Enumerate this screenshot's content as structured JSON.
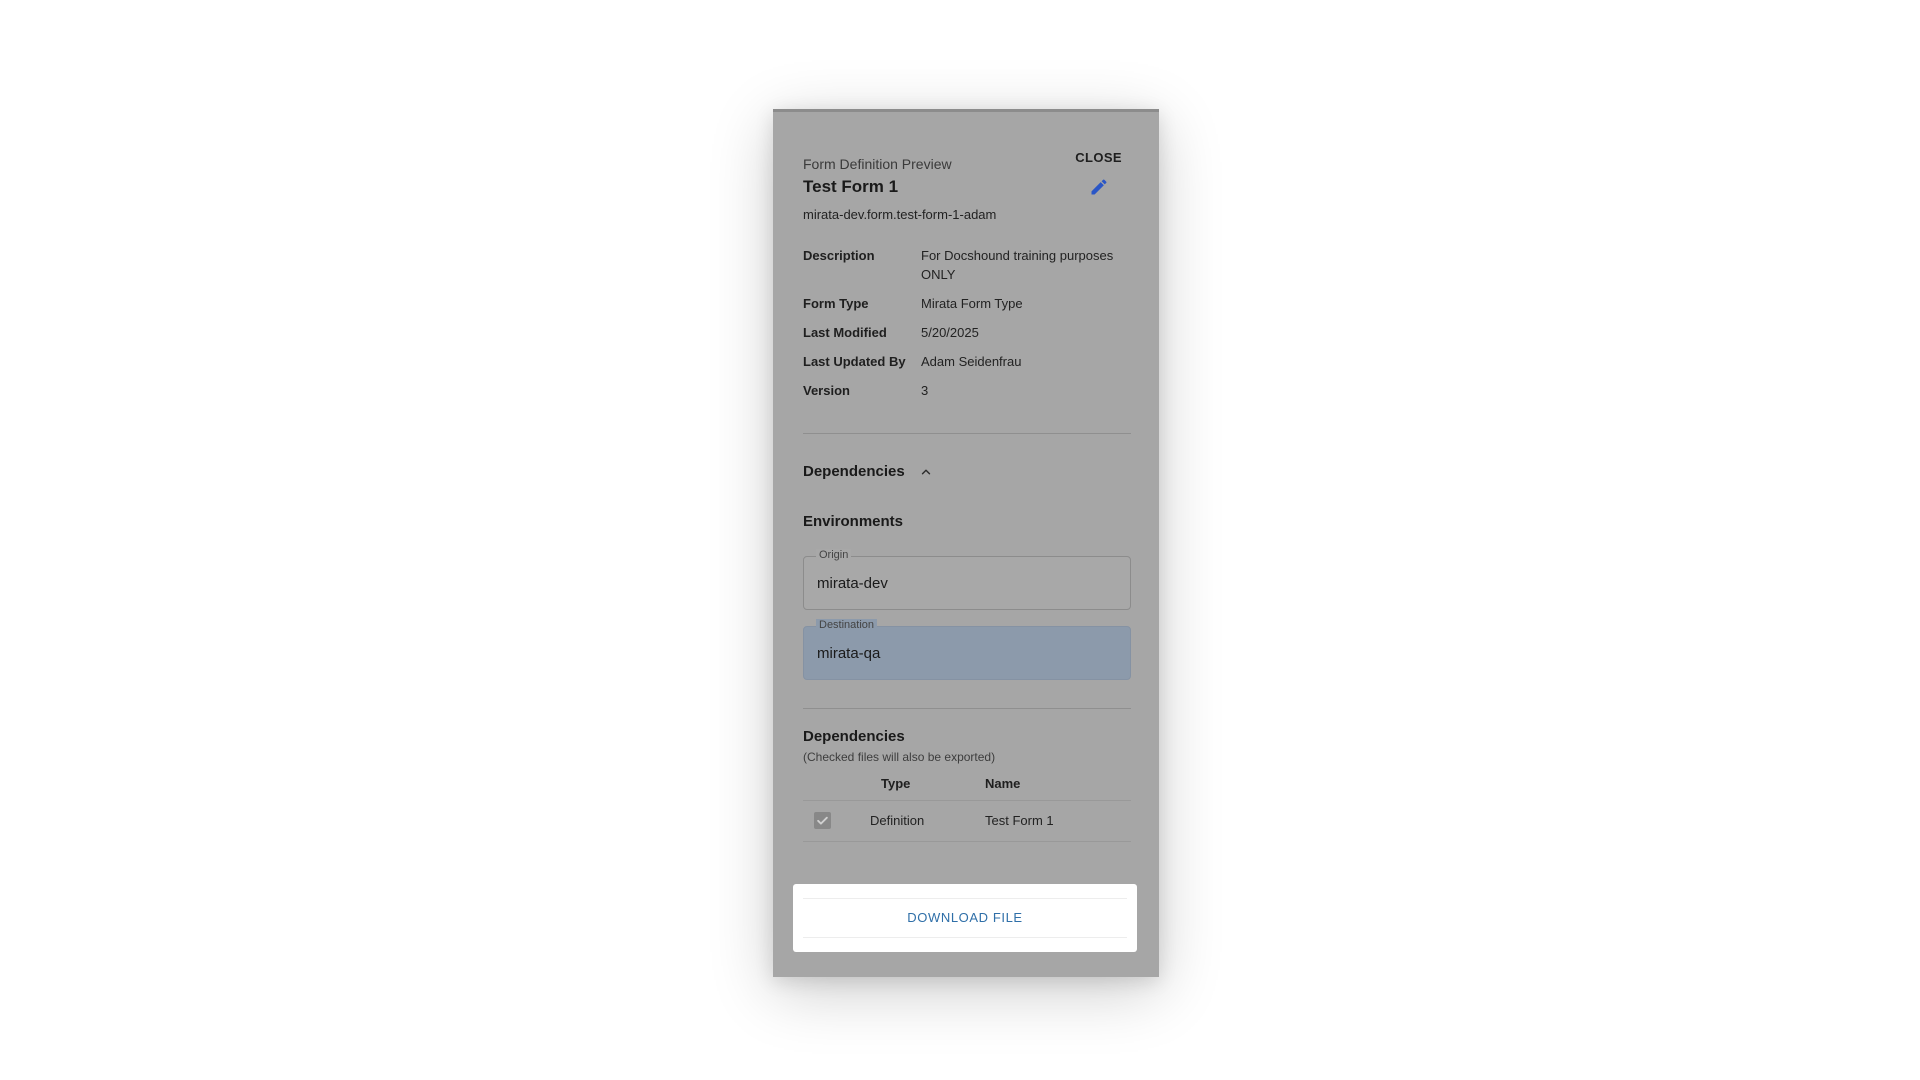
{
  "header": {
    "subtitle": "Form Definition Preview",
    "title": "Test Form 1",
    "identifier": "mirata-dev.form.test-form-1-adam",
    "close_label": "CLOSE"
  },
  "details": [
    {
      "label": "Description",
      "value": "For Docshound training purposes ONLY"
    },
    {
      "label": "Form Type",
      "value": "Mirata Form Type"
    },
    {
      "label": "Last Modified",
      "value": "5/20/2025"
    },
    {
      "label": "Last Updated By",
      "value": "Adam Seidenfrau"
    },
    {
      "label": "Version",
      "value": "3"
    }
  ],
  "dependencies_section": {
    "toggle_label": "Dependencies",
    "environments_heading": "Environments",
    "origin": {
      "label": "Origin",
      "value": "mirata-dev"
    },
    "destination": {
      "label": "Destination",
      "value": "mirata-qa"
    }
  },
  "dependencies_table": {
    "heading": "Dependencies",
    "note": "(Checked files will also be exported)",
    "columns": {
      "type": "Type",
      "name": "Name"
    },
    "rows": [
      {
        "checked": true,
        "type": "Definition",
        "name": "Test Form 1"
      }
    ]
  },
  "footer": {
    "download_label": "DOWNLOAD FILE"
  },
  "colors": {
    "accent": "#2f6fa8",
    "edit_icon": "#2a56c6",
    "overlay": "#a6a6a6",
    "destination_highlight": "#8c9aab"
  },
  "icons": {
    "edit": "pencil-icon",
    "toggle": "chevron-up-icon",
    "check": "check-icon"
  }
}
